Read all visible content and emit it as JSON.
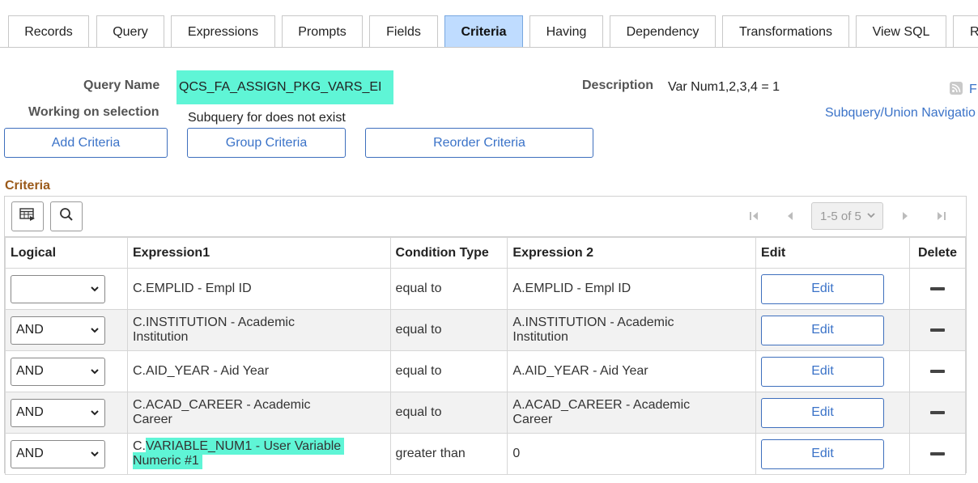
{
  "tabs": [
    {
      "label": "Records"
    },
    {
      "label": "Query"
    },
    {
      "label": "Expressions"
    },
    {
      "label": "Prompts"
    },
    {
      "label": "Fields"
    },
    {
      "label": "Criteria"
    },
    {
      "label": "Having"
    },
    {
      "label": "Dependency"
    },
    {
      "label": "Transformations"
    },
    {
      "label": "View SQL"
    },
    {
      "label": "R"
    }
  ],
  "active_tab": "Criteria",
  "header": {
    "query_name_label": "Query Name",
    "query_name_value": "QCS_FA_ASSIGN_PKG_VARS_EI",
    "description_label": "Description",
    "description_value": "Var Num1,2,3,4 = 1",
    "working_label": "Working on selection",
    "working_value": "Subquery for does not exist",
    "feed_link": "F",
    "subquery_link": "Subquery/Union Navigatio"
  },
  "actions": {
    "add_criteria": "Add Criteria",
    "group_criteria": "Group Criteria",
    "reorder_criteria": "Reorder Criteria"
  },
  "criteria": {
    "title": "Criteria",
    "pager": "1-5 of 5",
    "columns": {
      "logical": "Logical",
      "expression1": "Expression1",
      "condition": "Condition Type",
      "expression2": "Expression 2",
      "edit": "Edit",
      "delete": "Delete"
    },
    "rows": [
      {
        "logical": "",
        "expr1_a": "C.EMPLID - Empl ID",
        "expr1_b": "",
        "condition": "equal to",
        "expr2_a": "A.EMPLID - Empl ID",
        "expr2_b": "",
        "edit": "Edit"
      },
      {
        "logical": "AND",
        "expr1_a": "C.INSTITUTION - Academic",
        "expr1_b": "Institution",
        "condition": "equal to",
        "expr2_a": "A.INSTITUTION - Academic",
        "expr2_b": "Institution",
        "edit": "Edit"
      },
      {
        "logical": "AND",
        "expr1_a": "C.AID_YEAR - Aid Year",
        "expr1_b": "",
        "condition": "equal to",
        "expr2_a": "A.AID_YEAR - Aid Year",
        "expr2_b": "",
        "edit": "Edit"
      },
      {
        "logical": "AND",
        "expr1_a": "C.ACAD_CAREER - Academic",
        "expr1_b": "Career",
        "condition": "equal to",
        "expr2_a": "A.ACAD_CAREER - Academic",
        "expr2_b": "Career",
        "edit": "Edit"
      },
      {
        "logical": "AND",
        "expr1_prefix": "C.",
        "expr1_a": "VARIABLE_NUM1 - User Variable",
        "expr1_b": "Numeric #1",
        "condition": "greater than",
        "expr2_a": "0",
        "expr2_b": "",
        "edit": "Edit"
      }
    ]
  },
  "colors": {
    "accent": "#3b73c8",
    "active_tab": "#bfdcff",
    "highlight": "#5ff5d6",
    "section_title": "#9b5a1a"
  }
}
